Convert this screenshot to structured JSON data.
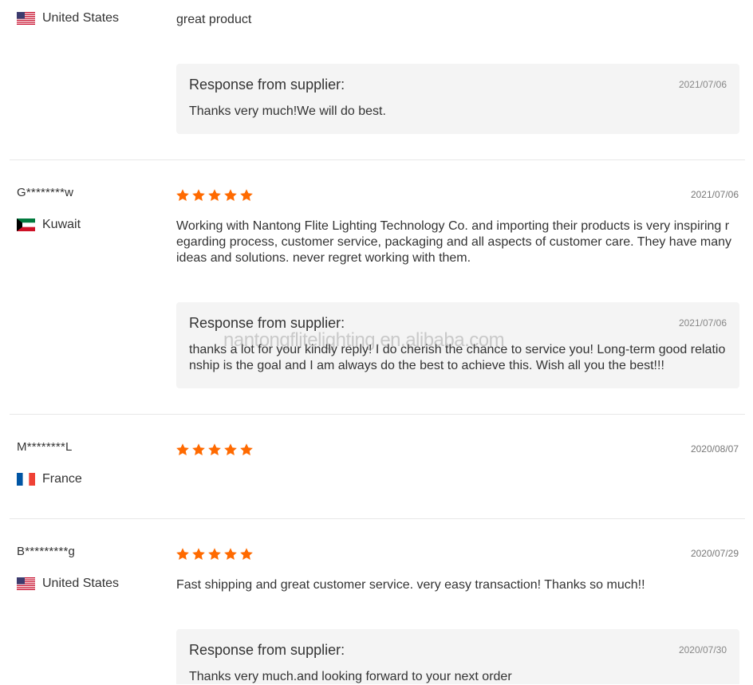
{
  "watermark": "nantongflitelighting.en.alibaba.com",
  "reviews": [
    {
      "user": "",
      "country": "United States",
      "flag": "us",
      "stars": 0,
      "date": "",
      "text": "great product",
      "response": {
        "title": "Response from supplier:",
        "date": "2021/07/06",
        "text": "Thanks very much!We will do best."
      }
    },
    {
      "user": "G********w",
      "country": "Kuwait",
      "flag": "kw",
      "stars": 5,
      "date": "2021/07/06",
      "text": "Working with Nantong Flite Lighting Technology Co. and importing their products is very inspiring regarding process, customer service, packaging and all aspects of customer care. They have many ideas and solutions. never regret working with them.",
      "response": {
        "title": "Response from supplier:",
        "date": "2021/07/06",
        "text": "thanks a lot for your kindly reply! I do cherish the chance to service you! Long-term good relationship is the goal and I am always do the best to achieve this. Wish all you the best!!!"
      }
    },
    {
      "user": "M********L",
      "country": "France",
      "flag": "fr",
      "stars": 5,
      "date": "2020/08/07",
      "text": ""
    },
    {
      "user": "B*********g",
      "country": "United States",
      "flag": "us",
      "stars": 5,
      "date": "2020/07/29",
      "text": "Fast shipping and great customer service. very easy transaction! Thanks so much!!",
      "response": {
        "title": "Response from supplier:",
        "date": "2020/07/30",
        "text": "Thanks very much.and looking forward to your next order"
      }
    }
  ],
  "colors": {
    "star": "#ff6a00",
    "response_bg": "#f4f4f4",
    "divider": "#e8e8e8"
  }
}
